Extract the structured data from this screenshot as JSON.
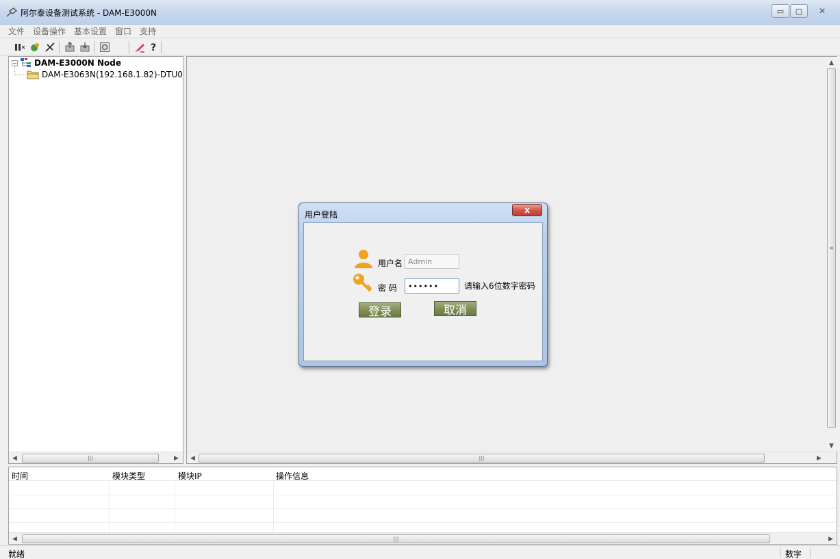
{
  "window": {
    "title": "阿尔泰设备测试系统 - DAM-E3000N"
  },
  "menu": [
    "文件",
    "设备操作",
    "基本设置",
    "窗口",
    "支持"
  ],
  "tree": {
    "root_label": "DAM-E3000N Node",
    "child_label": "DAM-E3063N(192.168.1.82)-DTU0"
  },
  "login_dialog": {
    "title": "用户登陆",
    "close_symbol": "x",
    "username_label": "用户名",
    "username_value": "Admin",
    "password_label": "密 码",
    "password_value": "••••••",
    "password_hint": "请输入6位数字密码",
    "login_button": "登录",
    "cancel_button": "取消"
  },
  "log_table": {
    "columns": [
      "时间",
      "模块类型",
      "模块IP",
      "操作信息"
    ]
  },
  "statusbar": {
    "status": "就绪",
    "indicator": "数字"
  },
  "icons": {
    "toolbar": [
      "connect-icon",
      "search-device-icon",
      "disconnect-icon",
      "upload-icon",
      "download-icon",
      "settings-icon",
      "edit-icon",
      "help-icon"
    ]
  },
  "colors": {
    "accent_button": "#7f8d55",
    "dialog_close": "#c13e30",
    "titlebar": "#c9d9ee"
  }
}
